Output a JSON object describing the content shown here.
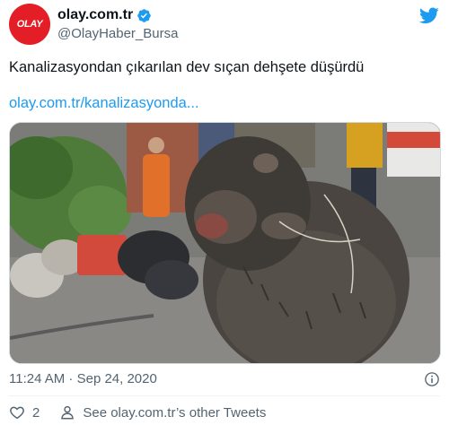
{
  "account": {
    "avatar_text": "OLAY",
    "display_name": "olay.com.tr",
    "handle": "@OlayHaber_Bursa",
    "verified": true
  },
  "tweet": {
    "text": "Kanalizasyondan çıkarılan dev sıçan dehşete düşürdü",
    "link": "olay.com.tr/kanalizasyonda..."
  },
  "meta": {
    "timestamp": "11:24 AM · Sep 24, 2020"
  },
  "actions": {
    "like_count": "2",
    "profile_label": "See olay.com.tr’s other Tweets"
  },
  "icons": {
    "brand": "twitter-bird-icon",
    "verified": "verified-badge-icon",
    "info": "info-icon",
    "like": "heart-icon",
    "profile": "person-icon"
  },
  "colors": {
    "brand_red": "#e41e26",
    "twitter_blue": "#1d9bf0",
    "secondary_text": "#536471",
    "primary_text": "#0f1419"
  }
}
